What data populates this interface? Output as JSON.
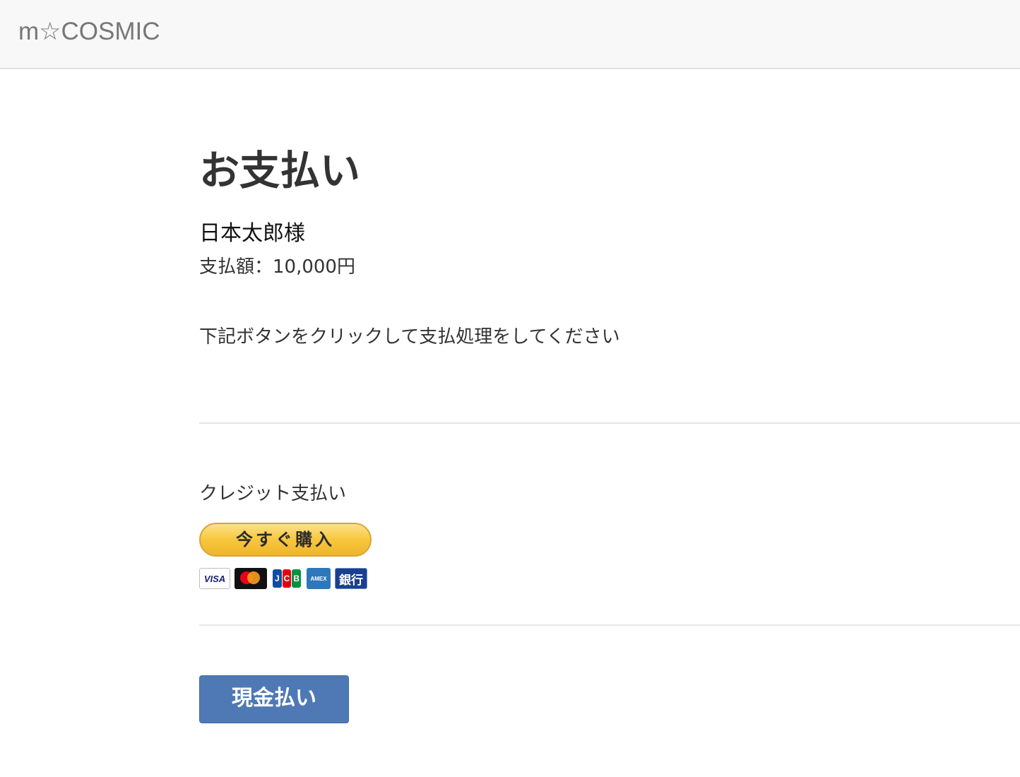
{
  "navbar": {
    "brand": "m☆COSMIC"
  },
  "main": {
    "title": "お支払い",
    "customer_name": "日本太郎様",
    "amount_line": "支払額：10,000円",
    "instruction": "下記ボタンをクリックして支払処理をしてください",
    "credit_section": {
      "heading": "クレジット支払い",
      "buy_button_label": "今すぐ購入",
      "card_logos": [
        {
          "name": "visa-logo-icon",
          "text": "VISA"
        },
        {
          "name": "mastercard-logo-icon",
          "text": ""
        },
        {
          "name": "jcb-logo-icon",
          "text": "JCB"
        },
        {
          "name": "amex-logo-icon",
          "text": "AMEX"
        },
        {
          "name": "bank-logo-icon",
          "text": "銀行"
        }
      ]
    },
    "cash_button_label": "現金払い"
  },
  "colors": {
    "navbar_bg": "#f8f8f8",
    "brand_text": "#777777",
    "cash_button_bg": "#4f79b4",
    "buy_button_bg": "#f7c73d"
  }
}
